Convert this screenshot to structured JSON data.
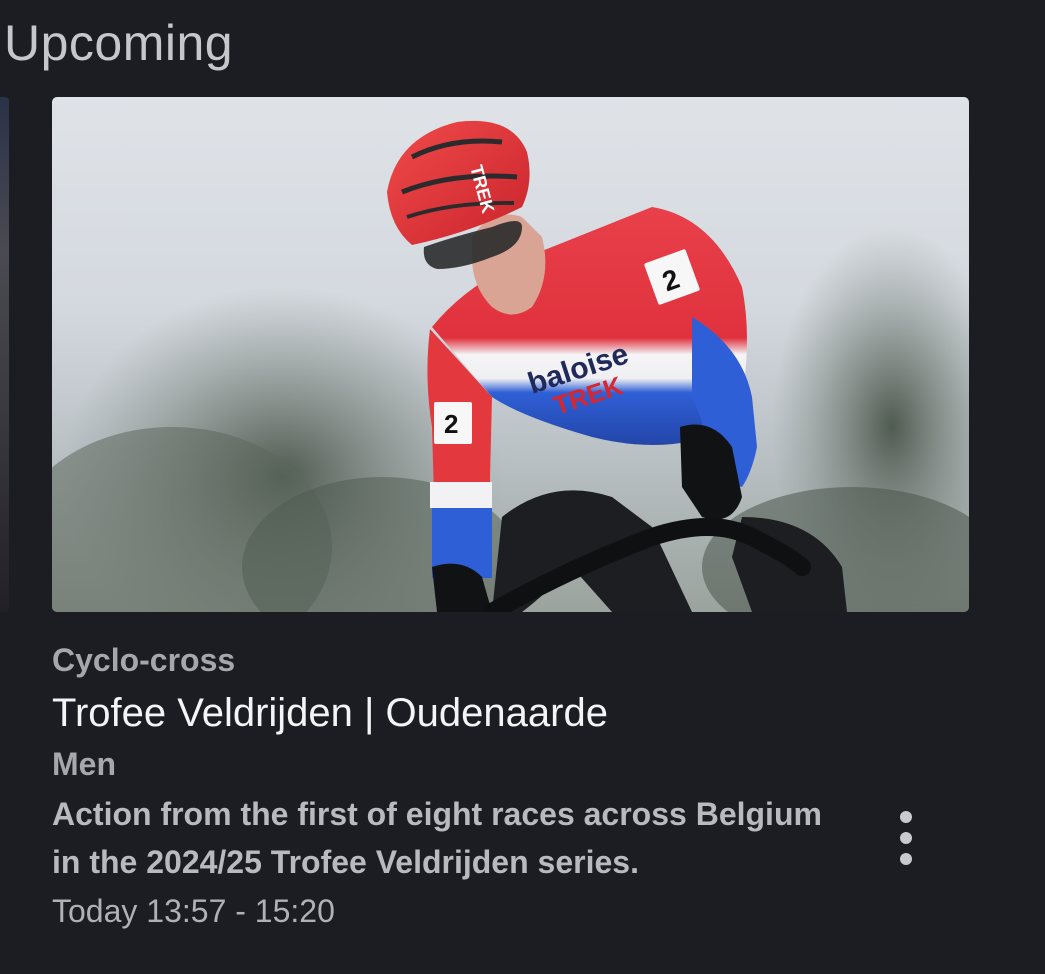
{
  "section": {
    "title": "Upcoming"
  },
  "card": {
    "image_alt": "Cyclist in Dutch champion jersey riding cyclo-cross",
    "category": "Cyclo-cross",
    "title": "Trofee Veldrijden | Oudenaarde",
    "subtitle": "Men",
    "description": "Action from the first of eight races across Belgium in the 2024/25 Trofee Veldrijden series.",
    "time": "Today 13:57 - 15:20",
    "more_icon": "more-vertical-icon"
  },
  "colors": {
    "background": "#1c1d22",
    "title_text": "#f4f4f6",
    "secondary_text": "#a6a6ab"
  }
}
